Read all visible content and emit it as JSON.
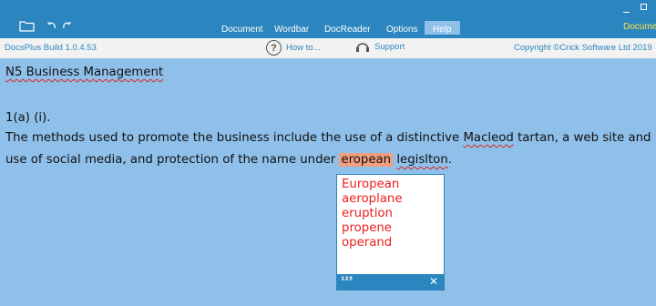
{
  "menu": {
    "items": [
      {
        "label": "Document",
        "active": false
      },
      {
        "label": "Wordbar",
        "active": false
      },
      {
        "label": "DocReader",
        "active": false
      },
      {
        "label": "Options",
        "active": false
      },
      {
        "label": "Help",
        "active": true
      }
    ],
    "right_label": "Documer"
  },
  "infobar": {
    "build": "DocsPlus Build 1.0.4.53",
    "howto": "How to...",
    "support": "Support",
    "copyright": "Copyright ©Crick Software Ltd 2019"
  },
  "doc": {
    "title": "N5 Business Management",
    "question": "1(a) (i).",
    "line1_pre": "The methods used to promote the business include the use of a distinctive ",
    "line1_spell": "Macleod",
    "line1_post": " tartan, a web site and",
    "line2_pre": "use of social media, and protection of the name under ",
    "line2_highlight": "eropean",
    "line2_spell": "legislton",
    "line2_post": "."
  },
  "suggestions": [
    "European",
    "aeroplane",
    "eruption",
    "propene",
    "operand"
  ],
  "popup": {
    "num_icon": "¹²³",
    "close": "✕"
  },
  "colors": {
    "titlebar": "#2b85be",
    "background": "#8fc0ea",
    "highlight": "#f39e7e",
    "suggestion": "#ee1c1c",
    "accent_yellow": "#ffe04a"
  },
  "icons": [
    "folder-icon",
    "undo-icon",
    "redo-icon",
    "help-icon",
    "support-icon",
    "close-icon"
  ]
}
